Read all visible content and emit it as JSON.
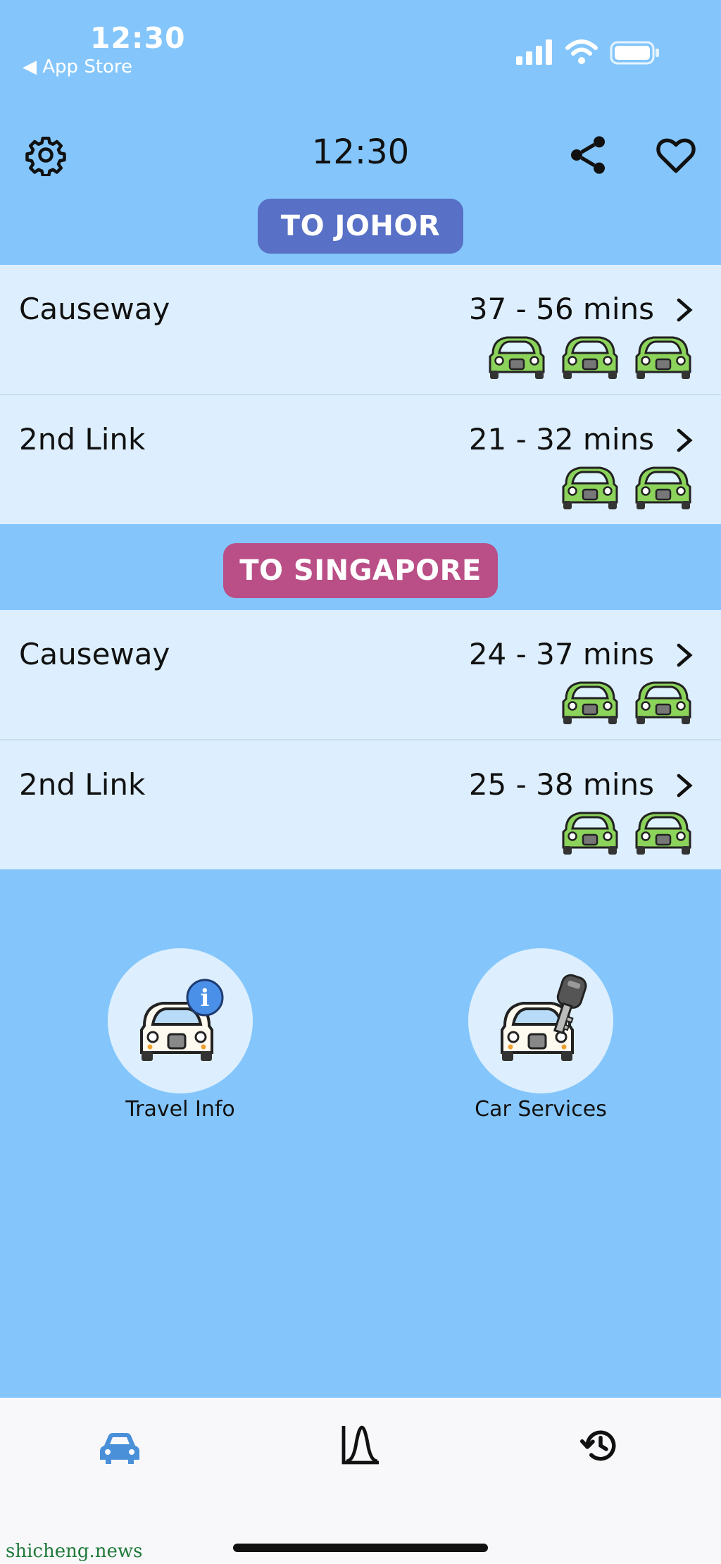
{
  "status_bar": {
    "time": "12:30",
    "back_label": "◀ App Store"
  },
  "header": {
    "time": "12:30"
  },
  "sections": {
    "to_johor": {
      "label": "TO JOHOR",
      "routes": [
        {
          "name": "Causeway",
          "time": "37 - 56 mins",
          "cars": 3
        },
        {
          "name": "2nd Link",
          "time": "21 - 32 mins",
          "cars": 2
        }
      ]
    },
    "to_singapore": {
      "label": "TO SINGAPORE",
      "routes": [
        {
          "name": "Causeway",
          "time": "24 - 37 mins",
          "cars": 2
        },
        {
          "name": "2nd Link",
          "time": "25 - 38 mins",
          "cars": 2
        }
      ]
    }
  },
  "actions": {
    "travel_info": "Travel Info",
    "car_services": "Car Services"
  },
  "tabs": [
    "car-icon",
    "chart-icon",
    "history-icon"
  ],
  "watermark": "shicheng.news",
  "colors": {
    "background": "#84c6fb",
    "row": "#ddeffe",
    "johor_pill": "#5870c6",
    "singapore_pill": "#b94f86",
    "traffic_green": "#8bd35a",
    "active_tab": "#4a90d9"
  }
}
